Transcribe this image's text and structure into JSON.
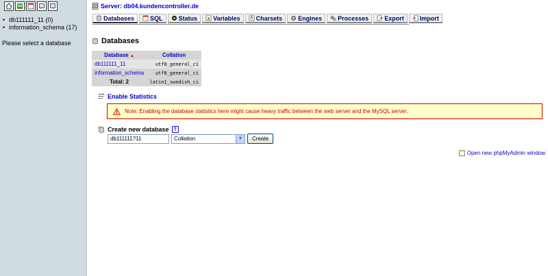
{
  "left": {
    "icon_buttons": [
      "home-icon",
      "query-window-icon",
      "sql-icon",
      "docs-icon",
      "help-icon"
    ],
    "databases": [
      {
        "label": "db111111_11 (0)"
      },
      {
        "label": "information_schema (17)"
      }
    ],
    "hint": "Please select a database"
  },
  "server": {
    "label": "Server: db04.kundencontroller.de"
  },
  "tabs": [
    {
      "label": "Databases",
      "icon": "database-icon"
    },
    {
      "label": "SQL",
      "icon": "sql-icon"
    },
    {
      "label": "Status",
      "icon": "status-icon"
    },
    {
      "label": "Variables",
      "icon": "variables-icon"
    },
    {
      "label": "Charsets",
      "icon": "charsets-icon"
    },
    {
      "label": "Engines",
      "icon": "engines-icon"
    },
    {
      "label": "Processes",
      "icon": "processes-icon"
    },
    {
      "label": "Export",
      "icon": "export-icon"
    },
    {
      "label": "Import",
      "icon": "import-icon"
    }
  ],
  "main": {
    "heading": "Databases",
    "table": {
      "headers": {
        "database": "Database",
        "collation": "Collation"
      },
      "rows": [
        {
          "name": "db111111_11",
          "collation": "utf8_general_ci"
        },
        {
          "name": "information_schema",
          "collation": "utf8_general_ci"
        }
      ],
      "total_label": "Total: 2",
      "total_collation": "latin1_swedish_ci"
    },
    "enable_statistics": "Enable Statistics",
    "note": "Note: Enabling the database statistics here might cause heavy traffic between the web server and the MySQL server.",
    "create": {
      "label": "Create new database",
      "input_value": "db111111?11",
      "collation_selected": "Collation",
      "button": "Create"
    },
    "new_window_link": "Open new phpMyAdmin window"
  },
  "colors": {
    "link": "#0000cc",
    "left_bg": "#d0dce0",
    "note_bg": "#ffffcc",
    "note_border": "#cc0000"
  }
}
